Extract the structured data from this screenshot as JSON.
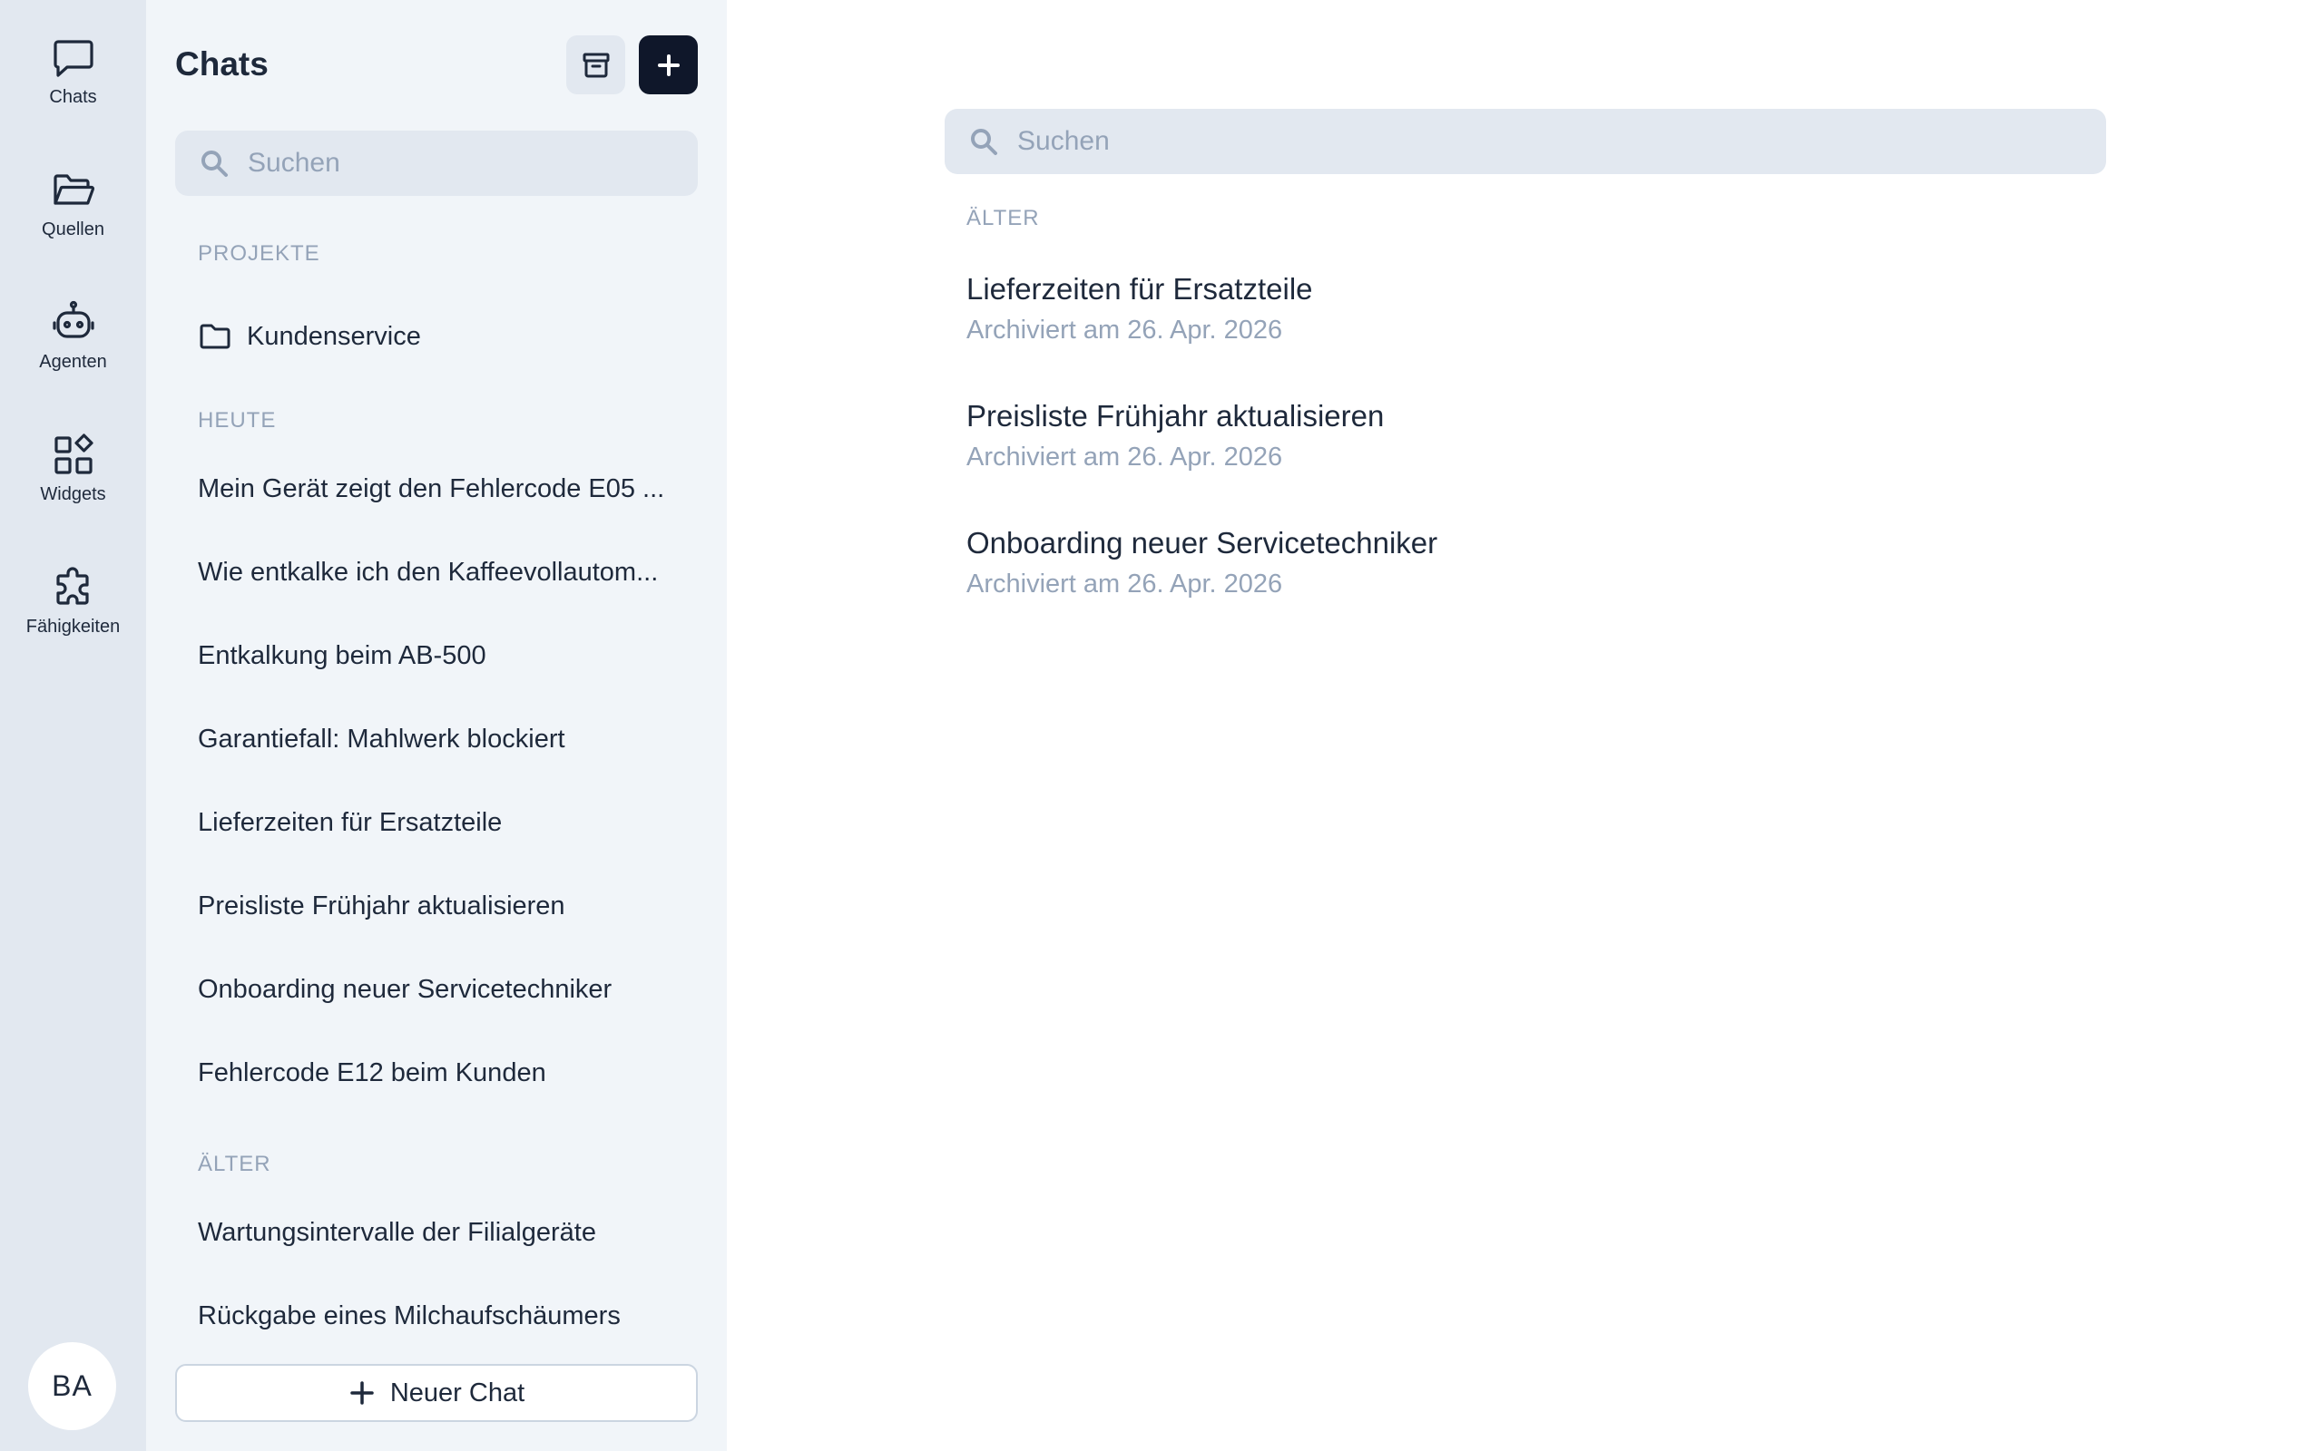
{
  "rail": {
    "items": [
      {
        "label": "Chats",
        "icon": "chat-bubble-icon"
      },
      {
        "label": "Quellen",
        "icon": "folder-open-icon"
      },
      {
        "label": "Agenten",
        "icon": "robot-icon"
      },
      {
        "label": "Widgets",
        "icon": "widgets-icon"
      },
      {
        "label": "Fähigkeiten",
        "icon": "puzzle-icon"
      }
    ],
    "avatar": "BA"
  },
  "sidebar": {
    "title": "Chats",
    "search_placeholder": "Suchen",
    "projects_label": "PROJEKTE",
    "projects": [
      "Kundenservice"
    ],
    "today_label": "HEUTE",
    "today": [
      "Mein Gerät zeigt den Fehlercode E05 ...",
      "Wie entkalke ich den Kaffeevollautom...",
      "Entkalkung beim AB-500",
      "Garantiefall: Mahlwerk blockiert",
      "Lieferzeiten für Ersatzteile",
      "Preisliste Frühjahr aktualisieren",
      "Onboarding neuer Servicetechniker",
      "Fehlercode E12 beim Kunden"
    ],
    "older_label": "ÄLTER",
    "older": [
      "Wartungsintervalle der Filialgeräte",
      "Rückgabe eines Milchaufschäumers"
    ],
    "new_chat_label": "Neuer Chat"
  },
  "main": {
    "search_placeholder": "Suchen",
    "section_label": "ÄLTER",
    "archived": [
      {
        "title": "Lieferzeiten für Ersatzteile",
        "subtitle": "Archiviert am 26. Apr. 2026"
      },
      {
        "title": "Preisliste Frühjahr aktualisieren",
        "subtitle": "Archiviert am 26. Apr. 2026"
      },
      {
        "title": "Onboarding neuer Servicetechniker",
        "subtitle": "Archiviert am 26. Apr. 2026"
      }
    ]
  }
}
